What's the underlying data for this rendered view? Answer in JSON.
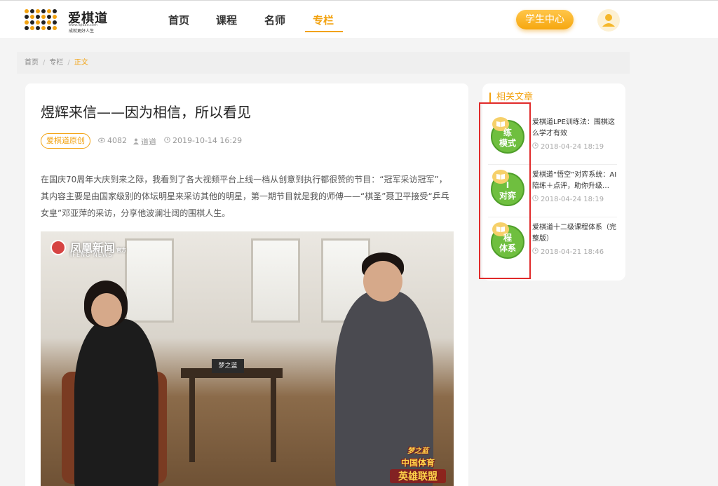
{
  "header": {
    "logo": {
      "name": "爱棋道",
      "url_text": "www.iqidao.com",
      "tagline": "成就更好人生"
    },
    "nav": [
      {
        "label": "首页",
        "active": false
      },
      {
        "label": "课程",
        "active": false
      },
      {
        "label": "名师",
        "active": false
      },
      {
        "label": "专栏",
        "active": true
      }
    ],
    "student_center_label": "学生中心",
    "accent_color": "#f2a20f"
  },
  "breadcrumb": {
    "items": [
      "首页",
      "专栏"
    ],
    "current": "正文"
  },
  "article": {
    "title": "煜辉来信——因为相信，所以看见",
    "tag": "爱棋道原创",
    "views": "4082",
    "author": "道道",
    "datetime": "2019-10-14 16:29",
    "body": "在国庆70周年大庆到来之际，我看到了各大视频平台上线一档从创意到执行都很赞的节目：“冠军采访冠军”，其内容主要是由国家级别的体坛明星来采访其他的明星，第一期节目就是我的师傅——“棋圣”聂卫平接受“乒乓女皇”邓亚萍的采访，分享他波澜壮阔的围棋人生。",
    "image": {
      "logo_cn": "凤凰新闻",
      "logo_side": "官方",
      "logo_en": "IFENG NEWS",
      "sign_text": "梦之蓝",
      "badge_line1": "梦之蓝",
      "badge_line2": "中国体育",
      "badge_line3": "英雄联盟"
    }
  },
  "sidebar": {
    "title": "相关文章",
    "items": [
      {
        "icon_line1": "练",
        "icon_line2": "模式",
        "title": "爱棋道LPE训练法：围棋这么学才有效",
        "date": "2018-04-24 18:19",
        "icon_color": "#6fbf3f"
      },
      {
        "icon_line1": "I",
        "icon_line2": "对弈",
        "title": "爱棋道“悟空”对弈系统：AI陪练＋点评，助你升级…",
        "date": "2018-04-24 18:19",
        "icon_color": "#6fbf3f"
      },
      {
        "icon_line1": "程",
        "icon_line2": "体系",
        "title": "爱棋道十二级课程体系（完整版）",
        "date": "2018-04-21 18:46",
        "icon_color": "#6fbf3f"
      }
    ]
  }
}
